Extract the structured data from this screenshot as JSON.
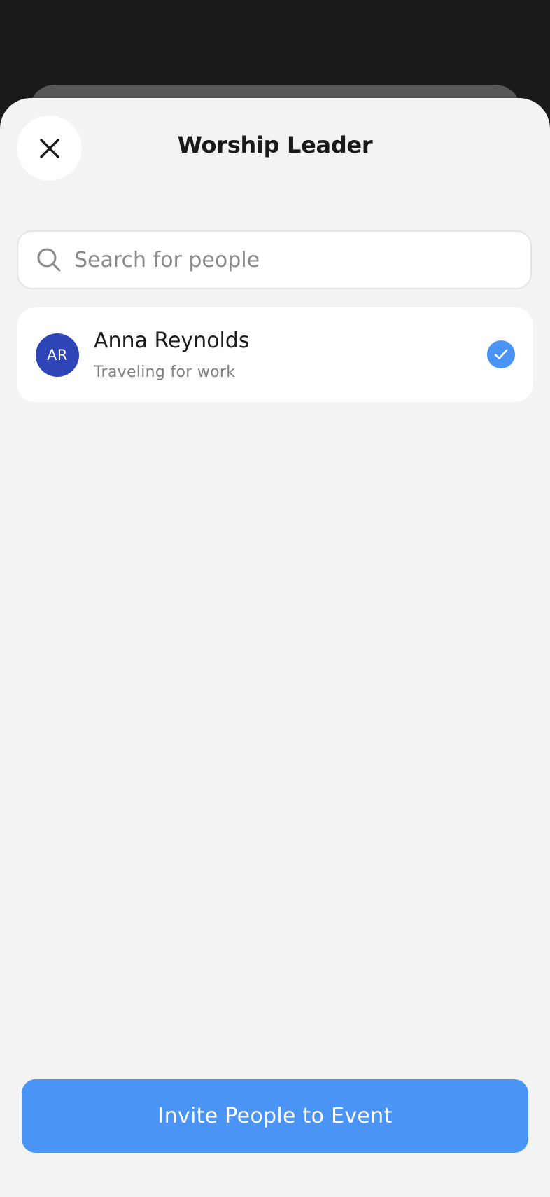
{
  "header": {
    "title": "Worship Leader",
    "close_icon": "close-icon"
  },
  "search": {
    "placeholder": "Search for people",
    "value": "",
    "icon": "search-icon"
  },
  "people": [
    {
      "initials": "AR",
      "name": "Anna Reynolds",
      "status": "Traveling for work",
      "selected": true,
      "avatar_color": "#2e45b8",
      "check_icon": "checkmark-icon"
    }
  ],
  "footer": {
    "invite_label": "Invite People to Event"
  },
  "colors": {
    "accent": "#4a94f6",
    "sheet_background": "#f3f3f4",
    "backdrop": "#1a1a1a"
  }
}
